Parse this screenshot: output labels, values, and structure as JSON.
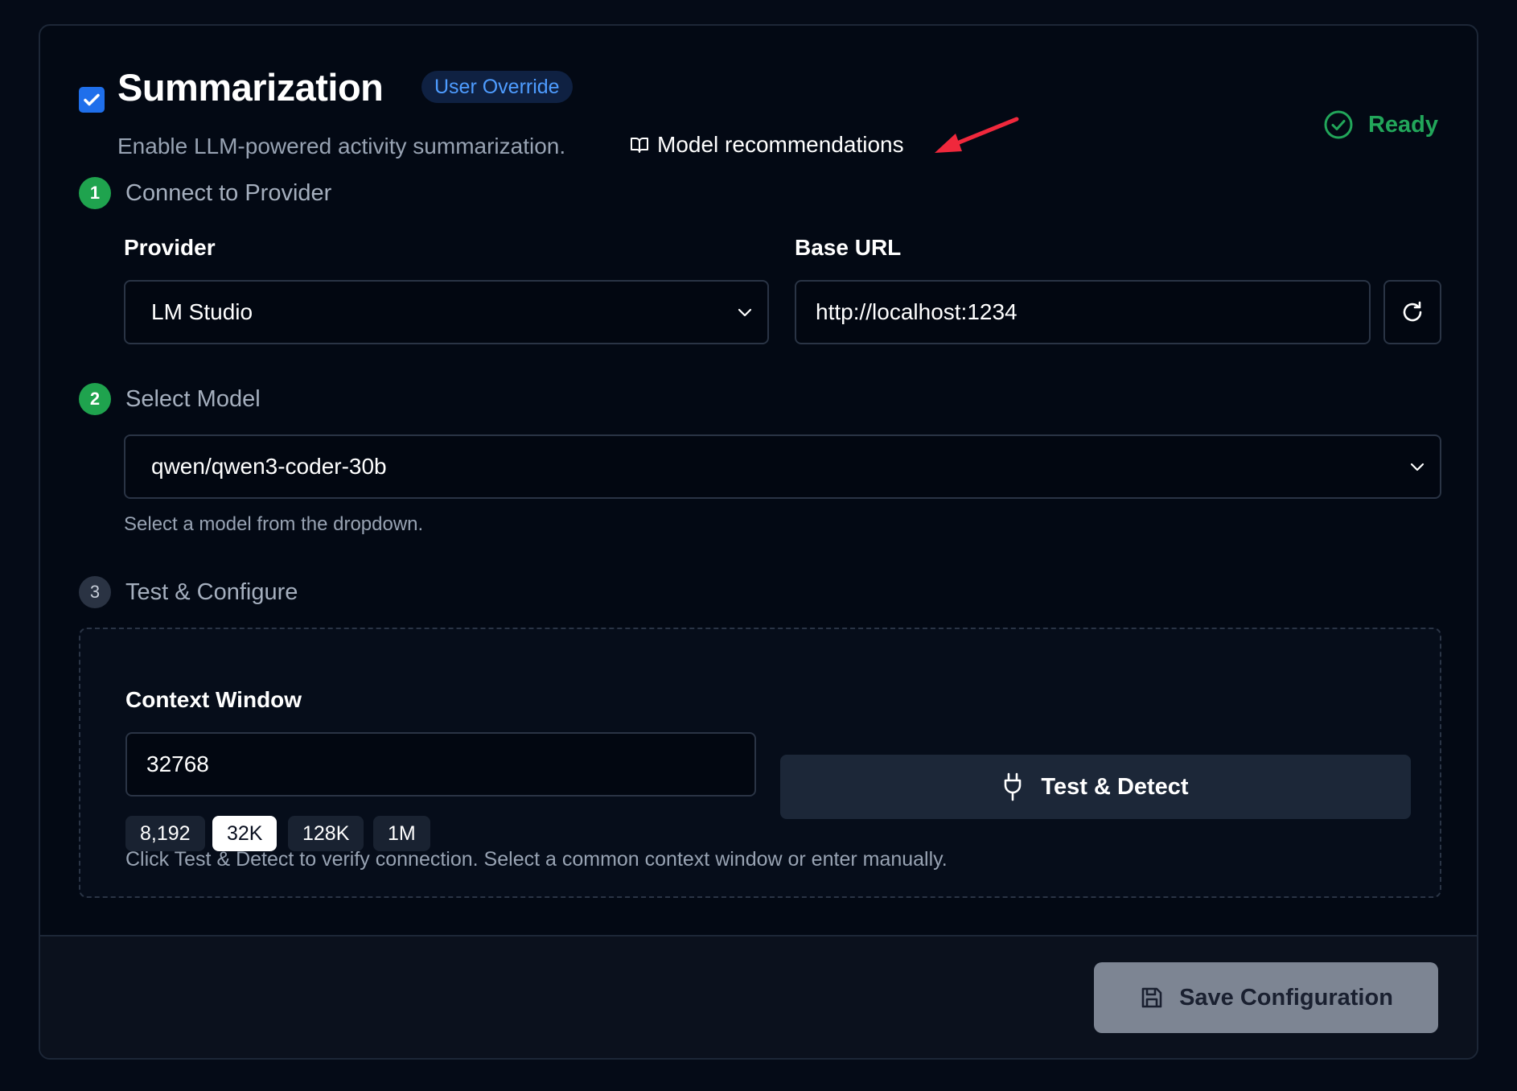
{
  "header": {
    "title": "Summarization",
    "badge": "User Override",
    "subtitle": "Enable LLM-powered activity summarization.",
    "recommendations_link": "Model recommendations",
    "status": "Ready",
    "enabled": true
  },
  "steps": {
    "step1": {
      "number": "1",
      "label": "Connect to Provider"
    },
    "step2": {
      "number": "2",
      "label": "Select Model"
    },
    "step3": {
      "number": "3",
      "label": "Test & Configure"
    }
  },
  "provider": {
    "label": "Provider",
    "value": "LM Studio"
  },
  "base_url": {
    "label": "Base URL",
    "value": "http://localhost:1234"
  },
  "model": {
    "value": "qwen/qwen3-coder-30b",
    "help": "Select a model from the dropdown."
  },
  "context_window": {
    "label": "Context Window",
    "value": "32768",
    "presets": [
      "8,192",
      "32K",
      "128K",
      "1M"
    ],
    "active_preset": "32K",
    "help": "Click Test & Detect to verify connection. Select a common context window or enter manually."
  },
  "test_button": "Test & Detect",
  "save_button": "Save Configuration",
  "colors": {
    "accent": "#1f6feb",
    "success": "#22a65a",
    "annotation_arrow": "#f0283c"
  }
}
